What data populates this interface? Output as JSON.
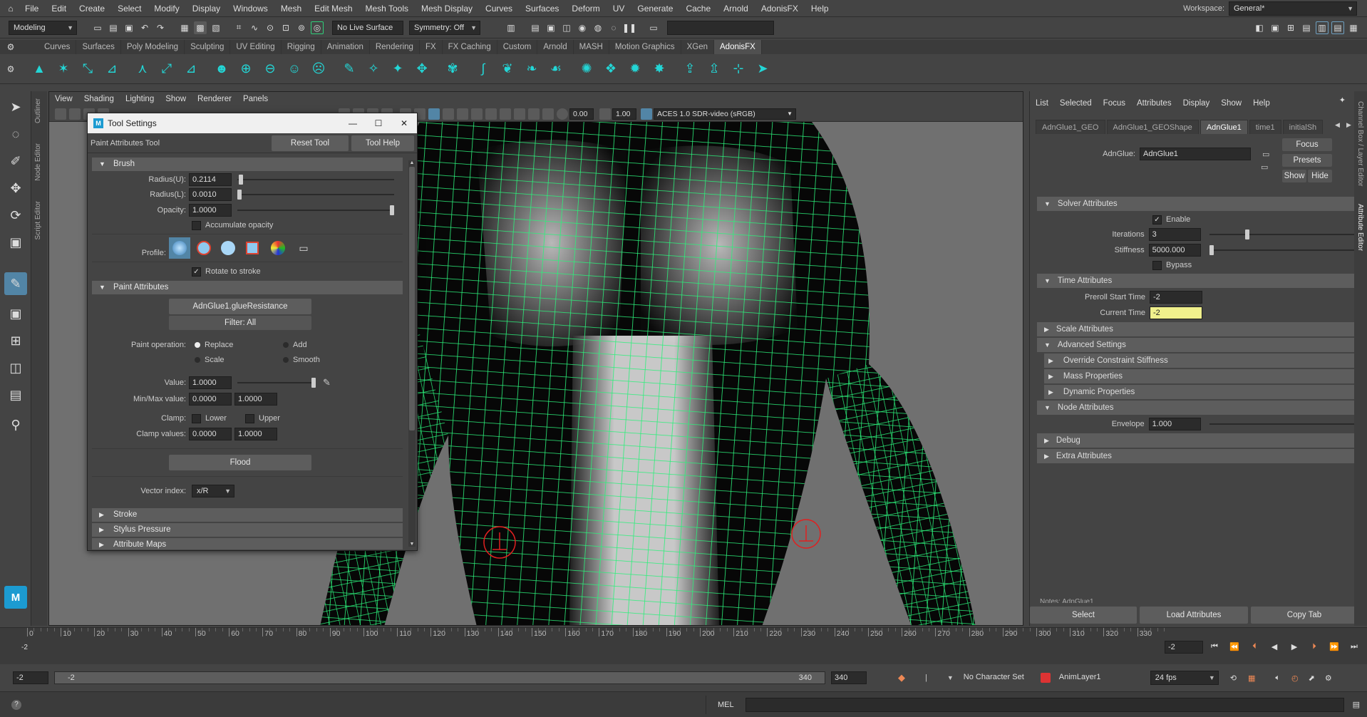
{
  "menubar": {
    "items": [
      "File",
      "Edit",
      "Create",
      "Select",
      "Modify",
      "Display",
      "Windows",
      "Mesh",
      "Edit Mesh",
      "Mesh Tools",
      "Mesh Display",
      "Curves",
      "Surfaces",
      "Deform",
      "UV",
      "Generate",
      "Cache",
      "Arnold",
      "AdonisFX",
      "Help"
    ],
    "workspace_label": "Workspace:",
    "workspace_value": "General*"
  },
  "statusline": {
    "mode": "Modeling",
    "live_surface": "No Live Surface",
    "symmetry": "Symmetry: Off"
  },
  "shelf_tabs": [
    "Curves",
    "Surfaces",
    "Poly Modeling",
    "Sculpting",
    "UV Editing",
    "Rigging",
    "Animation",
    "Rendering",
    "FX",
    "FX Caching",
    "Custom",
    "Arnold",
    "MASH",
    "Motion Graphics",
    "XGen",
    "AdonisFX"
  ],
  "shelf_active": "AdonisFX",
  "side_tabs": [
    "Outliner",
    "Node Editor",
    "Script Editor"
  ],
  "right_side_tabs": [
    "Channel Box / Layer Editor",
    "Attribute Editor"
  ],
  "viewport": {
    "menu": [
      "View",
      "Shading",
      "Lighting",
      "Show",
      "Renderer",
      "Panels"
    ],
    "value_a": "0.00",
    "value_b": "1.00",
    "color_space": "ACES 1.0 SDR-video (sRGB)"
  },
  "tool_settings": {
    "title": "Tool Settings",
    "tool_name": "Paint Attributes Tool",
    "reset_label": "Reset Tool",
    "help_label": "Tool Help",
    "brush": {
      "header": "Brush",
      "radius_u_label": "Radius(U):",
      "radius_u": "0.2114",
      "radius_l_label": "Radius(L):",
      "radius_l": "0.0010",
      "opacity_label": "Opacity:",
      "opacity": "1.0000",
      "accumulate_label": "Accumulate opacity",
      "profile_label": "Profile:",
      "rotate_label": "Rotate to stroke"
    },
    "paint_attributes": {
      "header": "Paint Attributes",
      "attribute": "AdnGlue1.glueResistance",
      "filter": "Filter: All",
      "operation_label": "Paint operation:",
      "op_replace": "Replace",
      "op_add": "Add",
      "op_scale": "Scale",
      "op_smooth": "Smooth",
      "value_label": "Value:",
      "value": "1.0000",
      "minmax_label": "Min/Max value:",
      "min": "0.0000",
      "max": "1.0000",
      "clamp_label": "Clamp:",
      "clamp_lower": "Lower",
      "clamp_upper": "Upper",
      "clamp_values_label": "Clamp values:",
      "clamp_min": "0.0000",
      "clamp_max": "1.0000",
      "flood_label": "Flood",
      "vector_index_label": "Vector index:",
      "vector_index": "x/R"
    },
    "collapsed": [
      "Stroke",
      "Stylus Pressure",
      "Attribute Maps"
    ]
  },
  "attribute_editor": {
    "menu": [
      "List",
      "Selected",
      "Focus",
      "Attributes",
      "Display",
      "Show",
      "Help"
    ],
    "tabs": [
      "AdnGlue1_GEO",
      "AdnGlue1_GEOShape",
      "AdnGlue1",
      "time1",
      "initialSh"
    ],
    "active_tab": "AdnGlue1",
    "node_label": "AdnGlue:",
    "node_value": "AdnGlue1",
    "focus_label": "Focus",
    "presets_label": "Presets",
    "show_label": "Show",
    "hide_label": "Hide",
    "solver": {
      "header": "Solver Attributes",
      "enable_label": "Enable",
      "iterations_label": "Iterations",
      "iterations": "3",
      "stiffness_label": "Stiffness",
      "stiffness": "5000.000",
      "bypass_label": "Bypass"
    },
    "time": {
      "header": "Time Attributes",
      "preroll_label": "Preroll Start Time",
      "preroll": "-2",
      "current_label": "Current Time",
      "current": "-2"
    },
    "scale_header": "Scale Attributes",
    "advanced": {
      "header": "Advanced Settings",
      "subs": [
        "Override Constraint Stiffness",
        "Mass Properties",
        "Dynamic Properties"
      ]
    },
    "node": {
      "header": "Node Attributes",
      "envelope_label": "Envelope",
      "envelope": "1.000"
    },
    "debug_header": "Debug",
    "extra_header": "Extra Attributes",
    "notes_label": "Notes: AdnGlue1",
    "select_label": "Select",
    "load_label": "Load Attributes",
    "copy_label": "Copy Tab"
  },
  "timeline": {
    "ticks": [
      "0",
      "10",
      "20",
      "30",
      "40",
      "50",
      "60",
      "70",
      "80",
      "90",
      "100",
      "110",
      "120",
      "130",
      "140",
      "150",
      "160",
      "170",
      "180",
      "190",
      "200",
      "210",
      "220",
      "230",
      "240",
      "250",
      "260",
      "270",
      "280",
      "290",
      "300",
      "310",
      "320",
      "330"
    ],
    "current": "-2",
    "current_field": "-2"
  },
  "range": {
    "start": "-2",
    "start_inner": "-2",
    "end_inner": "340",
    "end": "340",
    "character_set": "No Character Set",
    "anim_layer": "AnimLayer1",
    "fps": "24 fps"
  },
  "cmdline": {
    "mel_label": "MEL"
  }
}
